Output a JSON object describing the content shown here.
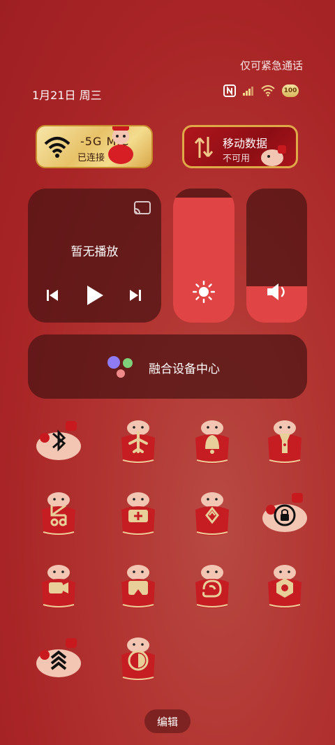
{
  "status": {
    "emergency_text": "仅可紧急通话",
    "date_text": "1月21日 周三",
    "battery_text": "100"
  },
  "wifi_tile": {
    "ssid_text": "-5G   MIC",
    "status_text": "已连接",
    "icon": "wifi-icon"
  },
  "data_tile": {
    "title": "移动数据",
    "status_text": "不可用",
    "icon": "mobile-data-icon"
  },
  "media": {
    "title": "暂无播放",
    "icons": [
      "cast-icon",
      "previous-icon",
      "play-icon",
      "next-icon"
    ]
  },
  "brightness": {
    "level": 0.93,
    "icon": "sun-icon"
  },
  "volume": {
    "level": 0.27,
    "icon": "speaker-icon"
  },
  "fusion": {
    "label": "融合设备中心"
  },
  "toggles": [
    {
      "icon": "bluetooth-icon"
    },
    {
      "icon": "airplane-icon"
    },
    {
      "icon": "bell-icon"
    },
    {
      "icon": "flashlight-icon"
    },
    {
      "icon": "screenshot-icon"
    },
    {
      "icon": "battery-saver-icon"
    },
    {
      "icon": "nfc-icon"
    },
    {
      "icon": "rotation-lock-icon"
    },
    {
      "icon": "screen-record-icon"
    },
    {
      "icon": "screen-cast-icon"
    },
    {
      "icon": "hotspot-icon"
    },
    {
      "icon": "settings-icon"
    },
    {
      "icon": "performance-icon"
    },
    {
      "icon": "dark-mode-icon"
    }
  ],
  "colors": {
    "accent": "#e14444",
    "panel": "#4a1414",
    "tile_gold": "#e8cf9a",
    "tile_red": "#c61d22"
  },
  "edit_label": "编辑"
}
